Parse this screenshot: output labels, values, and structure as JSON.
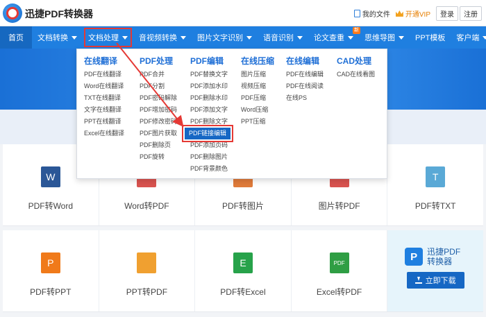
{
  "header": {
    "brand": "迅捷PDF转换器",
    "my_files": "我的文件",
    "vip": "开通VIP",
    "login": "登录",
    "register": "注册"
  },
  "nav": {
    "items": [
      {
        "label": "首页"
      },
      {
        "label": "文档转换"
      },
      {
        "label": "文档处理"
      },
      {
        "label": "音视频转换"
      },
      {
        "label": "图片文字识别"
      },
      {
        "label": "语音识别"
      },
      {
        "label": "论文查重",
        "badge": "新"
      },
      {
        "label": "思维导图"
      },
      {
        "label": "PPT模板"
      },
      {
        "label": "客户端"
      }
    ]
  },
  "dropdown": {
    "columns": [
      {
        "heading": "在线翻译",
        "items": [
          "PDF在线翻译",
          "Word在线翻译",
          "TXT在线翻译",
          "文字在线翻译",
          "PPT在线翻译",
          "Excel在线翻译"
        ]
      },
      {
        "heading": "PDF处理",
        "items": [
          "PDF合并",
          "PDF分割",
          "PDF密码解除",
          "PDF增加密码",
          "PDF修改密码",
          "PDF图片获取",
          "PDF删除页",
          "PDF旋转"
        ]
      },
      {
        "heading": "PDF编辑",
        "items": [
          "PDF替换文字",
          "PDF添加水印",
          "PDF删除水印",
          "PDF添加文字",
          "PDF删除文字",
          "PDF链接编辑",
          "PDF添加页码",
          "PDF删除图片",
          "PDF背景颜色"
        ]
      },
      {
        "heading": "在线压缩",
        "items": [
          "图片压缩",
          "视频压缩",
          "PDF压缩",
          "Word压缩",
          "PPT压缩"
        ]
      },
      {
        "heading": "在线编辑",
        "items": [
          "PDF在线编辑",
          "PDF在线阅读",
          "在线PS"
        ]
      },
      {
        "heading": "CAD处理",
        "items": [
          "CAD在线看图"
        ]
      }
    ],
    "highlighted": "PDF链接编辑"
  },
  "tools": {
    "row1": [
      {
        "label": "PDF转Word",
        "icon": "W",
        "color": "#2b5797"
      },
      {
        "label": "Word转PDF",
        "icon": "",
        "color": "#d9534f"
      },
      {
        "label": "PDF转图片",
        "icon": "",
        "color": "#e07b3a"
      },
      {
        "label": "图片转PDF",
        "icon": "",
        "color": "#d9534f"
      },
      {
        "label": "PDF转TXT",
        "icon": "T",
        "color": "#5aa9d6"
      }
    ],
    "row2": [
      {
        "label": "PDF转PPT",
        "icon": "P",
        "color": "#f07a1a"
      },
      {
        "label": "PPT转PDF",
        "icon": "",
        "color": "#f0a030"
      },
      {
        "label": "PDF转Excel",
        "icon": "E",
        "color": "#27a24a"
      },
      {
        "label": "Excel转PDF",
        "icon": "PDF",
        "color": "#2f9e44"
      }
    ]
  },
  "promo": {
    "name": "迅捷PDF转换器",
    "download": "立即下载"
  },
  "colors": {
    "nav": "#1f7fe0",
    "accent": "#1667c4",
    "annotation": "#e53935"
  }
}
